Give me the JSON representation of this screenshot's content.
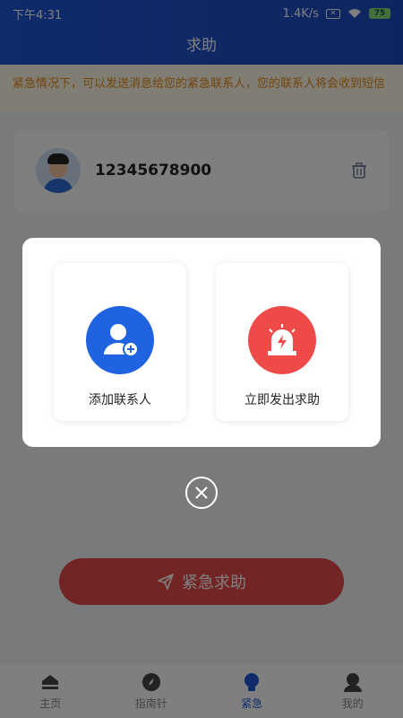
{
  "statusbar": {
    "time": "下午4:31",
    "speed": "1.4K/s",
    "battery": "75"
  },
  "header": {
    "title": "求助"
  },
  "notice": {
    "text": "紧急情况下，可以发送消息给您的紧急联系人，您的联系人将会收到短信"
  },
  "contact": {
    "phone": "12345678900"
  },
  "sos_button": {
    "label": "紧急求助"
  },
  "modal": {
    "options": [
      {
        "label": "添加联系人",
        "icon": "add-contact-icon",
        "color": "#1f63e0"
      },
      {
        "label": "立即发出求助",
        "icon": "alarm-light-icon",
        "color": "#ef4a4a"
      }
    ]
  },
  "tabbar": {
    "items": [
      {
        "label": "主页",
        "icon": "home-icon",
        "active": false
      },
      {
        "label": "指南针",
        "icon": "compass-icon",
        "active": false
      },
      {
        "label": "紧急",
        "icon": "bulb-icon",
        "active": true
      },
      {
        "label": "我的",
        "icon": "profile-icon",
        "active": false
      }
    ]
  },
  "colors": {
    "primary": "#1f56d8",
    "danger": "#e64848",
    "notice_text": "#e78a1a"
  }
}
